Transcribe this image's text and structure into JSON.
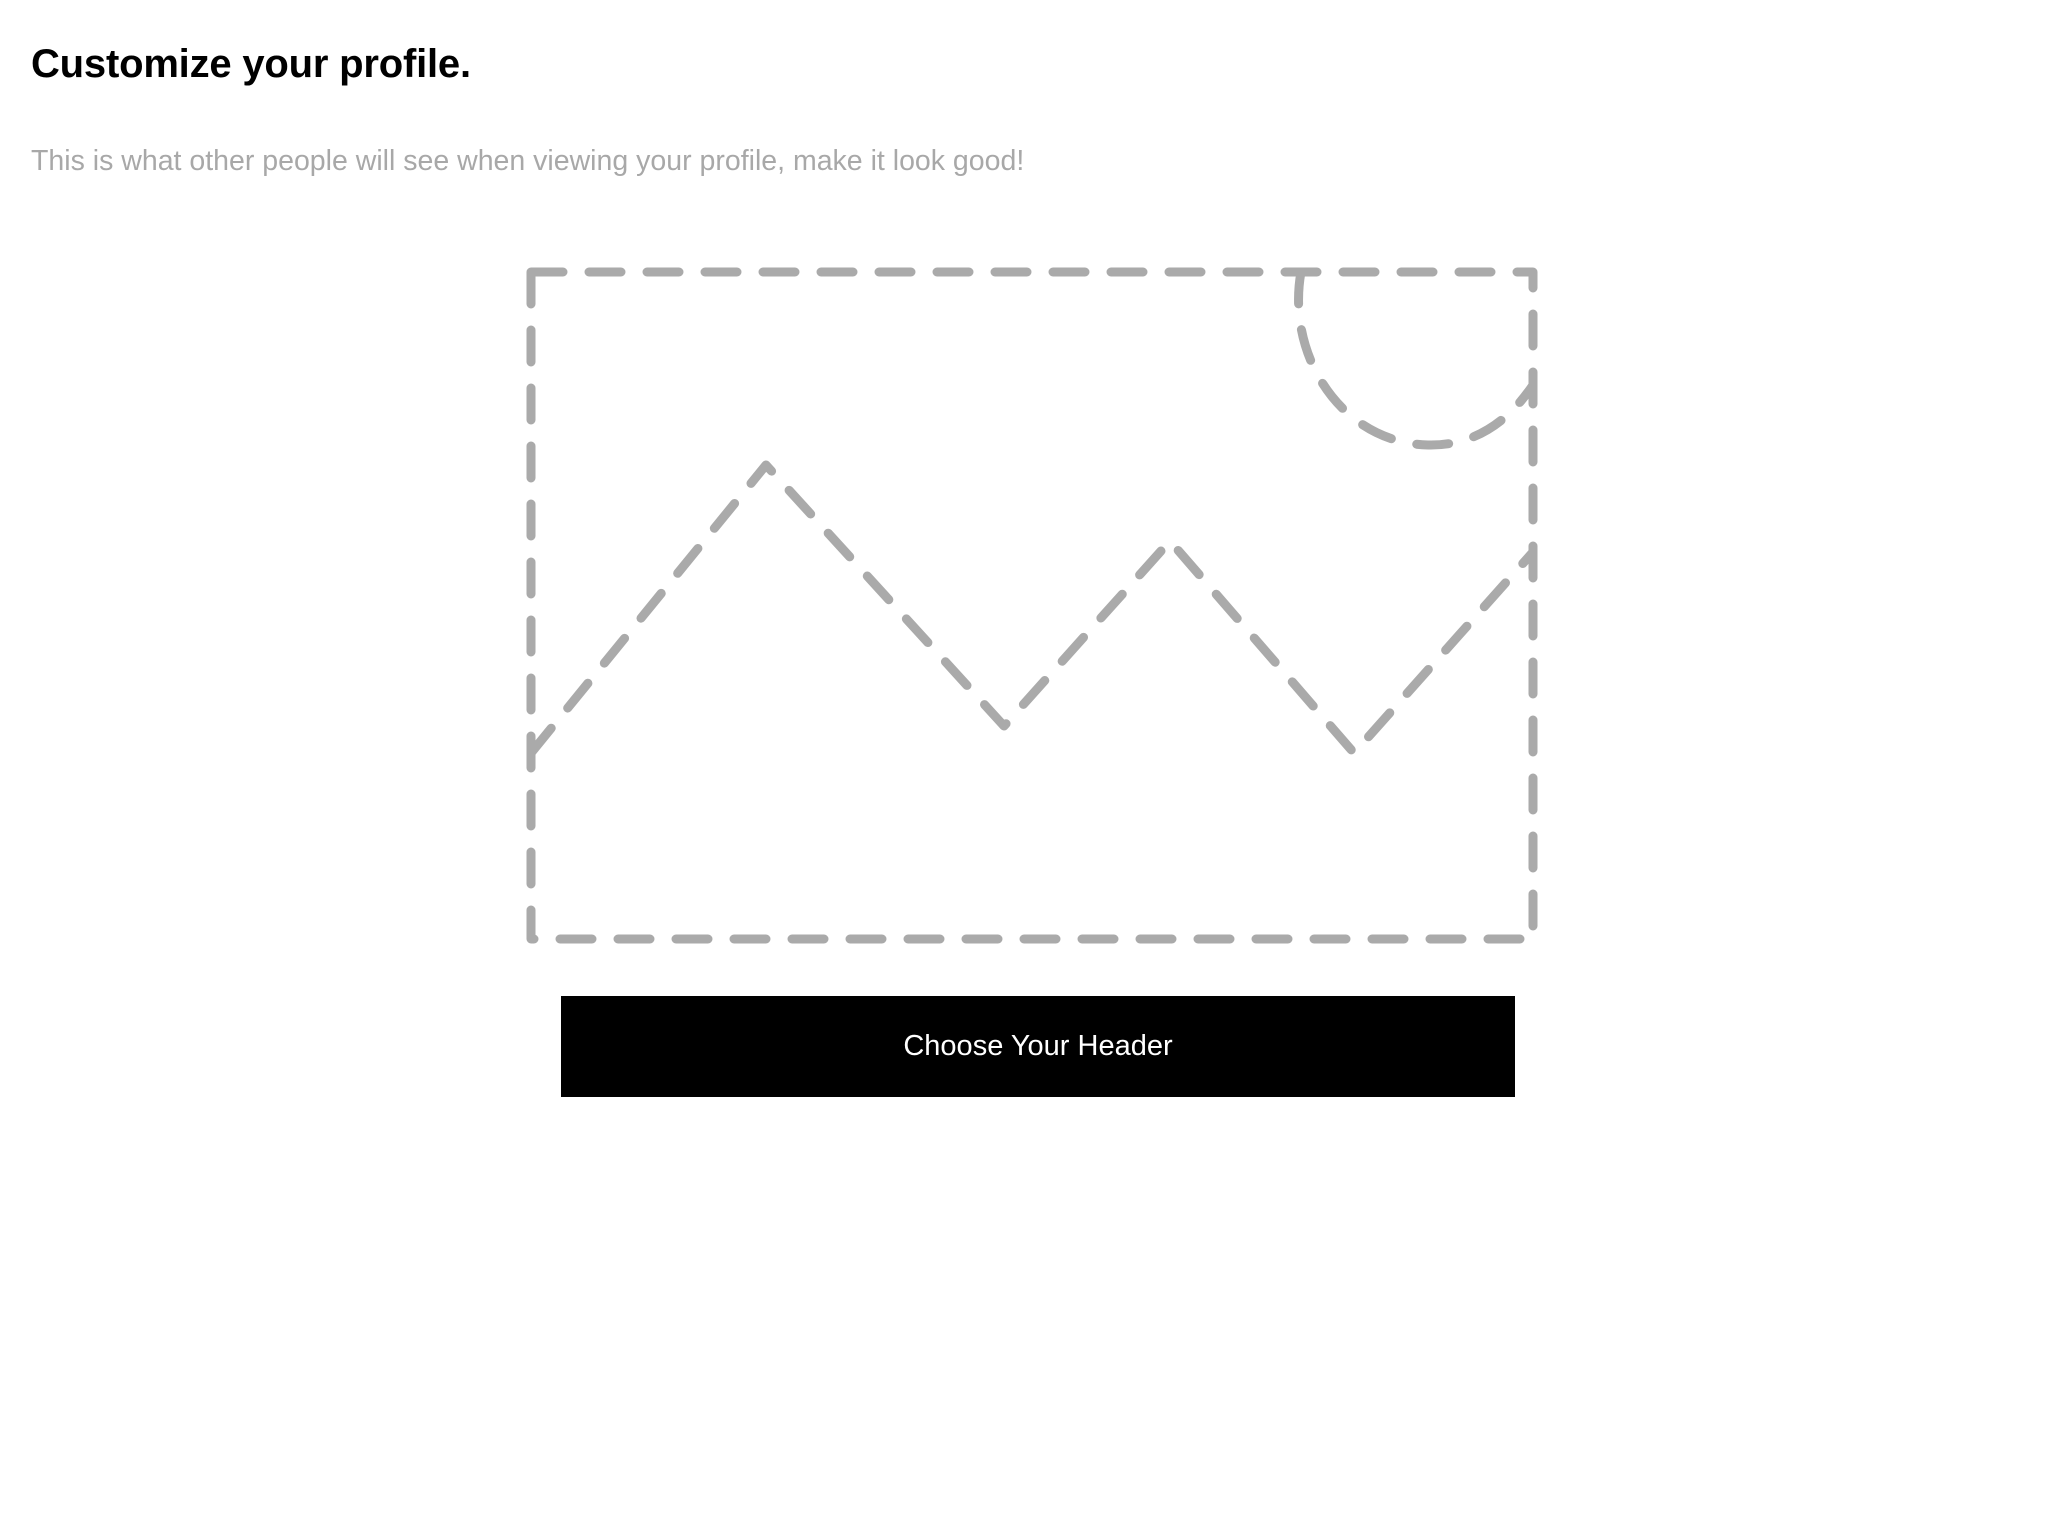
{
  "profile": {
    "title": "Customize your profile.",
    "subtitle": "This is what other people will see when viewing your profile, make it look good!"
  },
  "header_upload": {
    "placeholder_icon": "image-placeholder-icon",
    "button_label": "Choose Your Header"
  },
  "colors": {
    "title": "#000000",
    "subtitle": "#a8a8a8",
    "placeholder_stroke": "#aaaaaa",
    "button_background": "#000000",
    "button_text": "#ffffff"
  }
}
